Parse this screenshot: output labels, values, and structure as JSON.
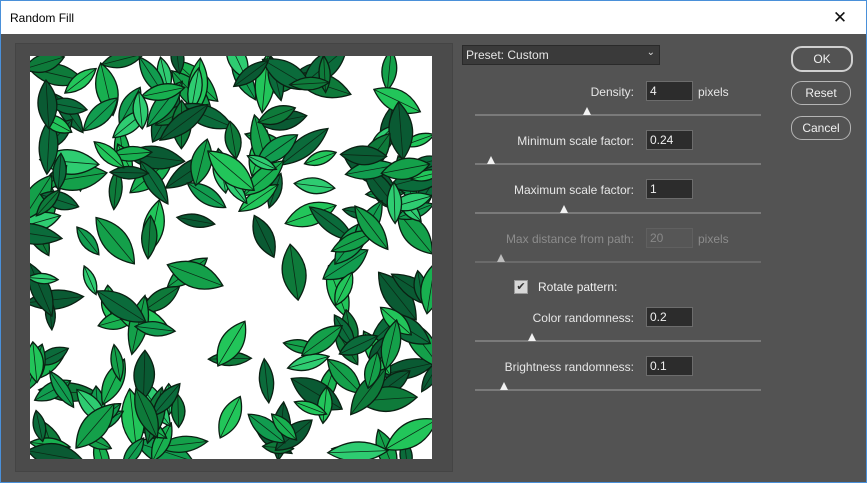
{
  "window": {
    "title": "Random Fill",
    "close_glyph": "✕"
  },
  "preset": {
    "label": "Preset:",
    "value": "Custom",
    "display": "Preset: Custom"
  },
  "params": [
    {
      "label": "Density:",
      "value": "4",
      "unit": "pixels",
      "disabled": false,
      "slider_fraction": 0.39
    },
    {
      "label": "Minimum scale factor:",
      "value": "0.24",
      "unit": "",
      "disabled": false,
      "slider_fraction": 0.055
    },
    {
      "label": "Maximum scale factor:",
      "value": "1",
      "unit": "",
      "disabled": false,
      "slider_fraction": 0.31
    },
    {
      "label": "Max distance from path:",
      "value": "20",
      "unit": "pixels",
      "disabled": true,
      "slider_fraction": 0.09
    },
    {
      "label": "Color randomness:",
      "value": "0.2",
      "unit": "",
      "disabled": false,
      "slider_fraction": 0.2
    },
    {
      "label": "Brightness randomness:",
      "value": "0.1",
      "unit": "",
      "disabled": false,
      "slider_fraction": 0.1
    }
  ],
  "rotate_pattern": {
    "label": "Rotate pattern:",
    "checked": true,
    "check_glyph": "✔"
  },
  "buttons": {
    "ok": "OK",
    "reset": "Reset",
    "cancel": "Cancel"
  },
  "preview": {
    "description": "random leaf fill preview",
    "leaf_colors": [
      "#0e7a3a",
      "#14a04a",
      "#22c55a",
      "#0b6b3b",
      "#18b050",
      "#0a5a33",
      "#2ecc71",
      "#119c4f"
    ]
  },
  "colors": {
    "background": "#535353",
    "accent_border": "#4a90d9"
  }
}
